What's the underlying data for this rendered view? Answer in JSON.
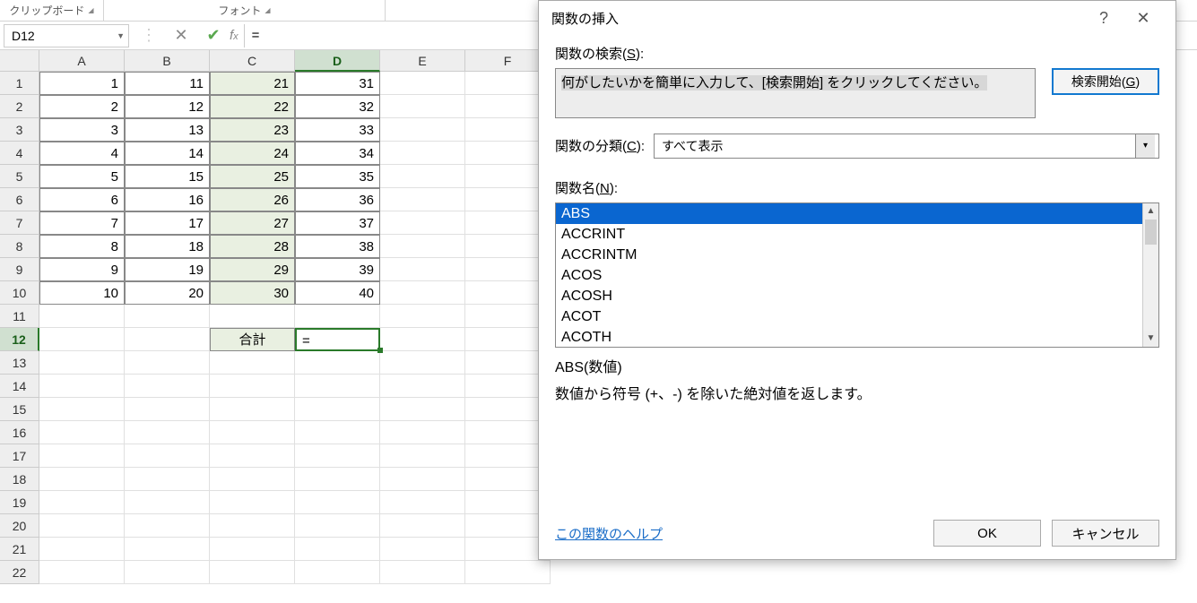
{
  "ribbon": {
    "clipboard": "クリップボード",
    "font": "フォント"
  },
  "formulaBar": {
    "nameBox": "D12",
    "fx": "fx",
    "formula": "="
  },
  "sheet": {
    "columns": [
      "A",
      "B",
      "C",
      "D",
      "E",
      "F"
    ],
    "activeCol": "D",
    "rows": [
      "1",
      "2",
      "3",
      "4",
      "5",
      "6",
      "7",
      "8",
      "9",
      "10",
      "11",
      "12",
      "13",
      "14",
      "15",
      "16",
      "17",
      "18",
      "19",
      "20",
      "21",
      "22"
    ],
    "activeRow": "12",
    "data": {
      "r1": {
        "A": "1",
        "B": "11",
        "C": "21",
        "D": "31"
      },
      "r2": {
        "A": "2",
        "B": "12",
        "C": "22",
        "D": "32"
      },
      "r3": {
        "A": "3",
        "B": "13",
        "C": "23",
        "D": "33"
      },
      "r4": {
        "A": "4",
        "B": "14",
        "C": "24",
        "D": "34"
      },
      "r5": {
        "A": "5",
        "B": "15",
        "C": "25",
        "D": "35"
      },
      "r6": {
        "A": "6",
        "B": "16",
        "C": "26",
        "D": "36"
      },
      "r7": {
        "A": "7",
        "B": "17",
        "C": "27",
        "D": "37"
      },
      "r8": {
        "A": "8",
        "B": "18",
        "C": "28",
        "D": "38"
      },
      "r9": {
        "A": "9",
        "B": "19",
        "C": "29",
        "D": "39"
      },
      "r10": {
        "A": "10",
        "B": "20",
        "C": "30",
        "D": "40"
      },
      "r12": {
        "C": "合計",
        "D": "="
      }
    }
  },
  "dialog": {
    "title": "関数の挿入",
    "searchLabel": "関数の検索(",
    "searchKey": "S",
    "searchLabelEnd": "):",
    "searchPlaceholder": "何がしたいかを簡単に入力して、[検索開始] をクリックしてください。",
    "goPrefix": "検索開始(",
    "goKey": "G",
    "goSuffix": ")",
    "categoryLabel": "関数の分類(",
    "categoryKey": "C",
    "categoryLabelEnd": "):",
    "categoryValue": "すべて表示",
    "fnNameLabel": "関数名(",
    "fnKey": "N",
    "fnNameLabelEnd": "):",
    "functions": [
      "ABS",
      "ACCRINT",
      "ACCRINTM",
      "ACOS",
      "ACOSH",
      "ACOT",
      "ACOTH"
    ],
    "selectedIndex": 0,
    "signature": "ABS(数値)",
    "description": "数値から符号 (+、-) を除いた絶対値を返します。",
    "helpLink": "この関数のヘルプ",
    "ok": "OK",
    "cancel": "キャンセル"
  }
}
